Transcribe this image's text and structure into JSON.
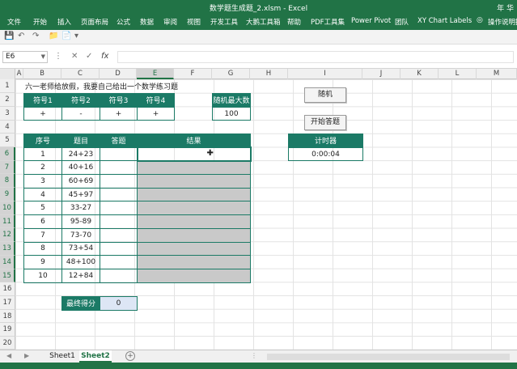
{
  "titlebar": {
    "title": "数学题生成题_2.xlsm  -  Excel",
    "user": "年 华"
  },
  "ribbon": {
    "tabs": [
      "文件",
      "开始",
      "插入",
      "页面布局",
      "公式",
      "数据",
      "审阅",
      "视图",
      "开发工具",
      "大鹅工具箱",
      "帮助",
      "PDF工具集",
      "Power Pivot",
      "团队",
      "XY Chart Labels"
    ],
    "tell_me": "操作说明搜"
  },
  "namebox": "E6",
  "formula": "",
  "columns": [
    "A",
    "B",
    "C",
    "D",
    "E",
    "F",
    "G",
    "H",
    "I",
    "J",
    "K",
    "L",
    "M"
  ],
  "rows": [
    "1",
    "2",
    "3",
    "4",
    "5",
    "6",
    "7",
    "8",
    "9",
    "10",
    "11",
    "12",
    "13",
    "14",
    "15",
    "16",
    "17",
    "18",
    "19",
    "20"
  ],
  "sheet": {
    "b1": "六一老师给放假，我要自己给出一个数学练习题",
    "symbol_headers": [
      "符号1",
      "符号2",
      "符号3",
      "符号4"
    ],
    "symbol_values": [
      "+",
      "-",
      "+",
      "+"
    ],
    "max_label": "随机最大数",
    "max_value": "100",
    "btn_random": "随机",
    "btn_start": "开始答题",
    "timer_label": "计时器",
    "timer_value": "0:00:04",
    "problems_headers": [
      "序号",
      "题目",
      "答题",
      "结果"
    ],
    "problems": [
      [
        "1",
        "24+23"
      ],
      [
        "2",
        "40+16"
      ],
      [
        "3",
        "60+69"
      ],
      [
        "4",
        "45+97"
      ],
      [
        "5",
        "33-27"
      ],
      [
        "6",
        "95-89"
      ],
      [
        "7",
        "73-70"
      ],
      [
        "8",
        "73+54"
      ],
      [
        "9",
        "48+100"
      ],
      [
        "10",
        "12+84"
      ]
    ],
    "score_label": "最终得分",
    "score_value": "0"
  },
  "sheet_tabs": [
    "Sheet1",
    "Sheet2"
  ],
  "active_sheet": "Sheet2"
}
